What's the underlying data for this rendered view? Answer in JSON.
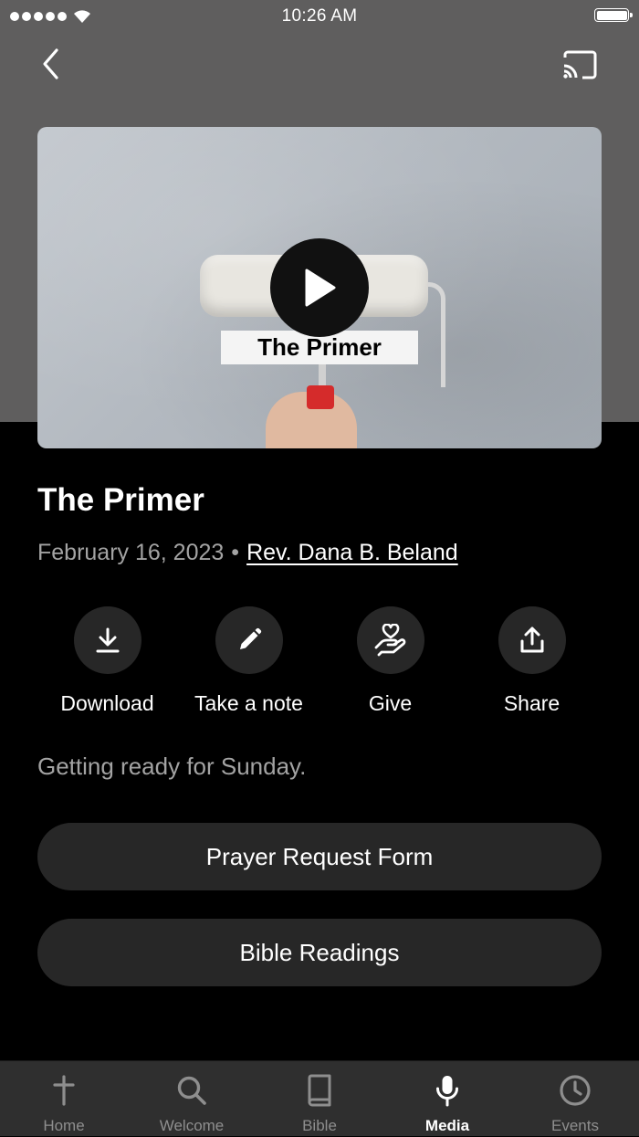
{
  "status_bar": {
    "time": "10:26 AM"
  },
  "video": {
    "overlay_title": "The Primer"
  },
  "episode": {
    "title": "The Primer",
    "date": "February 16, 2023",
    "separator": "•",
    "speaker": "Rev. Dana B. Beland",
    "description": "Getting ready for Sunday."
  },
  "actions": [
    {
      "label": "Download",
      "icon": "download-icon"
    },
    {
      "label": "Take a note",
      "icon": "pencil-icon"
    },
    {
      "label": "Give",
      "icon": "give-hand-heart-icon"
    },
    {
      "label": "Share",
      "icon": "share-icon"
    }
  ],
  "buttons": {
    "prayer_request": "Prayer Request Form",
    "bible_readings": "Bible Readings"
  },
  "tabs": [
    {
      "label": "Home",
      "icon": "cross-icon",
      "active": false
    },
    {
      "label": "Welcome",
      "icon": "search-icon",
      "active": false
    },
    {
      "label": "Bible",
      "icon": "book-icon",
      "active": false
    },
    {
      "label": "Media",
      "icon": "microphone-icon",
      "active": true
    },
    {
      "label": "Events",
      "icon": "clock-icon",
      "active": false
    }
  ],
  "colors": {
    "header_bg": "#5f5e5e",
    "page_bg": "#000000",
    "surface": "#272727",
    "tab_bar_bg": "#2f2f2f",
    "secondary_text": "#a3a3a3"
  }
}
